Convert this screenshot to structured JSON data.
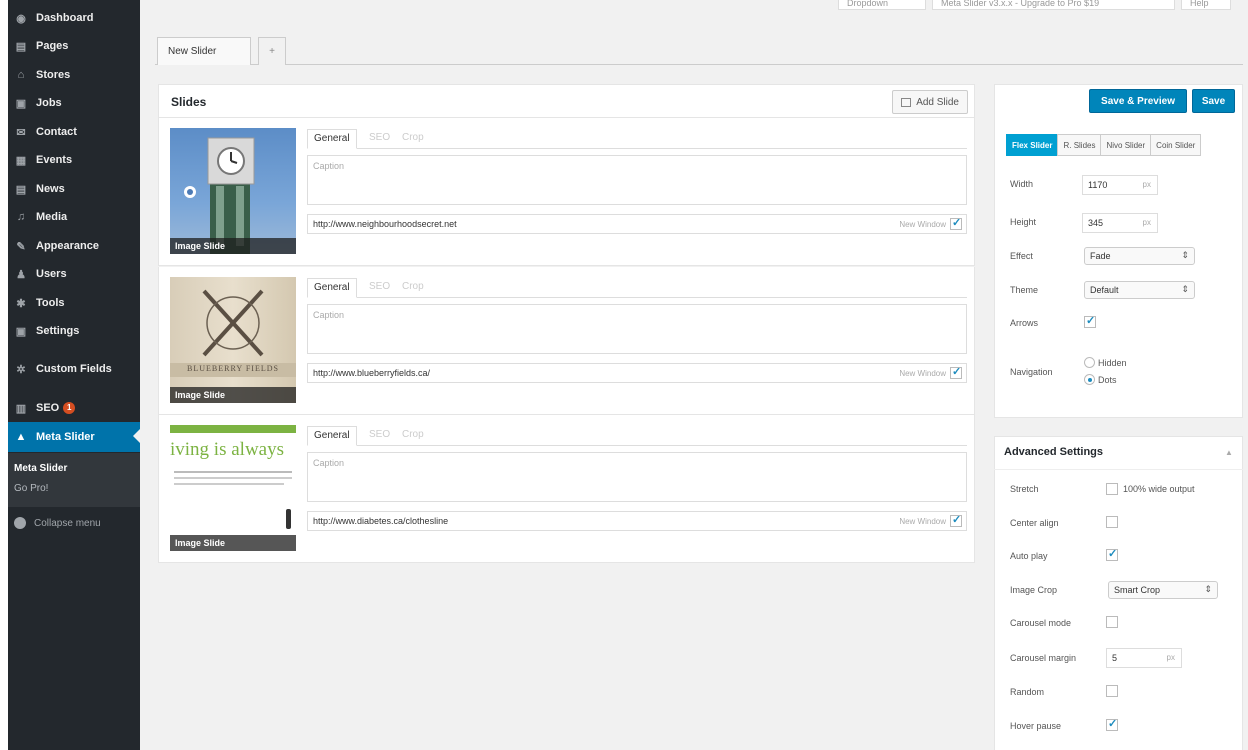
{
  "sidebar": {
    "items": [
      {
        "label": "Dashboard",
        "icon": "dashboard-icon",
        "glyph": "◉"
      },
      {
        "label": "Pages",
        "icon": "pages-icon",
        "glyph": "▤"
      },
      {
        "label": "Stores",
        "icon": "stores-icon",
        "glyph": "⌂"
      },
      {
        "label": "Jobs",
        "icon": "jobs-icon",
        "glyph": "▣"
      },
      {
        "label": "Contact",
        "icon": "contact-icon",
        "glyph": "✉"
      },
      {
        "label": "Events",
        "icon": "events-icon",
        "glyph": "▦"
      },
      {
        "label": "News",
        "icon": "news-icon",
        "glyph": "▤"
      },
      {
        "label": "Media",
        "icon": "media-icon",
        "glyph": "♫"
      },
      {
        "label": "Appearance",
        "icon": "appearance-icon",
        "glyph": "✎"
      },
      {
        "label": "Users",
        "icon": "users-icon",
        "glyph": "♟"
      },
      {
        "label": "Tools",
        "icon": "tools-icon",
        "glyph": "✱"
      },
      {
        "label": "Settings",
        "icon": "settings-icon",
        "glyph": "▣"
      },
      {
        "label": "Custom Fields",
        "icon": "custom-fields-icon",
        "glyph": "✲"
      },
      {
        "label": "SEO",
        "icon": "seo-icon",
        "glyph": "▥",
        "badge": "1"
      },
      {
        "label": "Meta Slider",
        "icon": "meta-slider-icon",
        "glyph": "▲"
      }
    ],
    "submenu": [
      "Meta Slider",
      "Go Pro!"
    ],
    "collapse_label": "Collapse menu"
  },
  "topbar": {
    "buttons": [
      "Dropdown",
      "Meta Slider v3.x.x - Upgrade to Pro $19",
      "Help"
    ]
  },
  "tabs": {
    "active": "New Slider",
    "add": "+"
  },
  "slides": {
    "title": "Slides",
    "add_label": "Add Slide",
    "tab_labels": [
      "General",
      "SEO",
      "Crop"
    ],
    "caption_placeholder": "Caption",
    "new_window_label": "New Window",
    "type_label": "Image Slide",
    "items": [
      {
        "url": "http://www.neighbourhoodsecret.net",
        "new_window": true
      },
      {
        "url": "http://www.blueberryfields.ca/",
        "new_window": true
      },
      {
        "url": "http://www.diabetes.ca/clothesline",
        "new_window": true
      }
    ],
    "thumb3_text": "iving is always",
    "thumb2_text": "BLUEBERRY FIELDS"
  },
  "settings": {
    "save_preview": "Save & Preview",
    "save": "Save",
    "slider_types": [
      "Flex Slider",
      "R. Slides",
      "Nivo Slider",
      "Coin Slider"
    ],
    "width_label": "Width",
    "width_value": "1170",
    "height_label": "Height",
    "height_value": "345",
    "unit": "px",
    "effect_label": "Effect",
    "effect_value": "Fade",
    "theme_label": "Theme",
    "theme_value": "Default",
    "arrows_label": "Arrows",
    "navigation_label": "Navigation",
    "nav_hidden": "Hidden",
    "nav_dots": "Dots"
  },
  "advanced": {
    "title": "Advanced Settings",
    "stretch_label": "Stretch",
    "stretch_text": "100% wide output",
    "center_label": "Center align",
    "autoplay_label": "Auto play",
    "crop_label": "Image Crop",
    "crop_value": "Smart Crop",
    "carousel_label": "Carousel mode",
    "carousel_margin_label": "Carousel margin",
    "carousel_margin_value": "5",
    "random_label": "Random",
    "hover_label": "Hover pause"
  },
  "colors": {
    "sidebar_bg": "#23282d",
    "accent": "#0073aa",
    "button_blue": "#0085ba",
    "flex_active": "#00a0d2"
  }
}
